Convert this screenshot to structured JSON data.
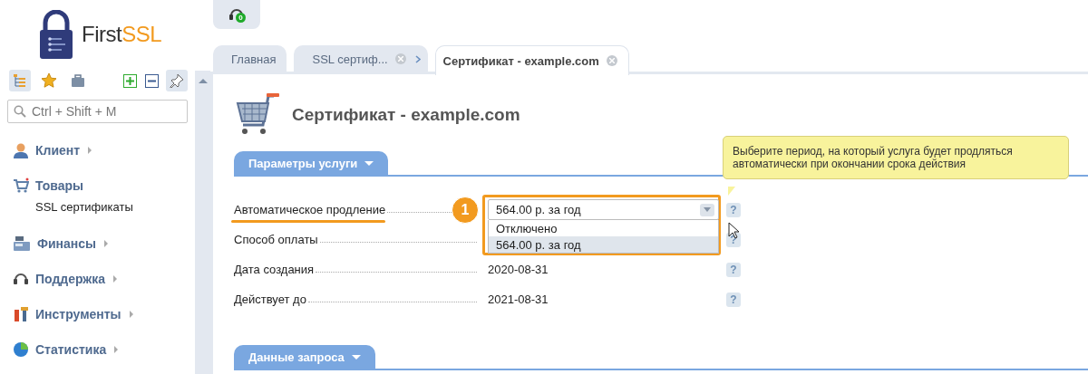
{
  "logo": {
    "text": "First",
    "accent": "SSL"
  },
  "sidebar": {
    "search": {
      "placeholder": "Ctrl + Shift + M"
    },
    "items": [
      {
        "label": "Клиент",
        "expanded": false
      },
      {
        "label": "Товары",
        "expanded": true,
        "children": [
          {
            "label": "SSL сертификаты"
          }
        ]
      },
      {
        "label": "Финансы",
        "expanded": false
      },
      {
        "label": "Поддержка",
        "expanded": false
      },
      {
        "label": "Инструменты",
        "expanded": false
      },
      {
        "label": "Статистика",
        "expanded": false
      }
    ]
  },
  "notifications": {
    "count": "0"
  },
  "tabs": [
    {
      "label": "Главная",
      "selected": false,
      "closable": false,
      "breadcrumb": false
    },
    {
      "label": "SSL сертиф...",
      "selected": false,
      "closable": true,
      "breadcrumb": true
    },
    {
      "label": "Сертификат - example.com",
      "selected": true,
      "closable": true,
      "breadcrumb": false
    }
  ],
  "page_title": "Сертификат - example.com",
  "sections": [
    {
      "title": "Параметры услуги",
      "fields": [
        {
          "label": "Автоматическое продление",
          "kind": "select",
          "value": "564.00 р. за год",
          "highlighted": true,
          "help": "?",
          "options": [
            {
              "label": "Отключено",
              "selected": false
            },
            {
              "label": "564.00 р. за год",
              "selected": true
            }
          ]
        },
        {
          "label": "Способ оплаты",
          "kind": "hidden",
          "highlighted": false,
          "help": "?"
        },
        {
          "label": "Дата создания",
          "kind": "text",
          "value": "2020-08-31",
          "highlighted": false,
          "help": "?"
        },
        {
          "label": "Действует до",
          "kind": "text",
          "value": "2021-08-31",
          "highlighted": false,
          "help": "?"
        }
      ]
    },
    {
      "title": "Данные запроса"
    }
  ],
  "callout": {
    "number": "1"
  },
  "tooltip": {
    "text": "Выберите период, на который услуга будет продляться автоматически при окончании срока действия"
  }
}
